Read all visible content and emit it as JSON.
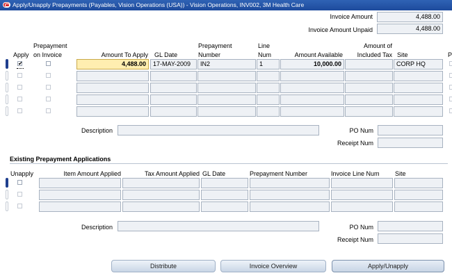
{
  "window": {
    "title": "Apply/Unapply Prepayments (Payables, Vision Operations (USA)) - Vision Operations, INV002, 3M Health Care"
  },
  "header": {
    "invoice_amount_label": "Invoice Amount",
    "invoice_amount_value": "4,488.00",
    "invoice_amount_unpaid_label": "Invoice Amount Unpaid",
    "invoice_amount_unpaid_value": "4,488.00"
  },
  "prepay_table": {
    "columns": {
      "apply": "Apply",
      "prepayment_on_invoice_1": "Prepayment",
      "prepayment_on_invoice_2": "on Invoice",
      "amount_to_apply": "Amount To Apply",
      "gl_date": "GL Date",
      "prepayment_number_1": "Prepayment",
      "prepayment_number_2": "Number",
      "line_num_1": "Line",
      "line_num_2": "Num",
      "amount_available": "Amount Available",
      "included_tax_1": "Amount of",
      "included_tax_2": "Included Tax",
      "site": "Site",
      "next_col": "P"
    },
    "rows": [
      {
        "apply": "✔",
        "amount_to_apply": "4,488.00",
        "gl_date": "17-MAY-2009",
        "prepayment_number": "IN2",
        "line_num": "1",
        "amount_available": "10,000.00",
        "included_tax": "",
        "site": "CORP HQ"
      },
      {
        "apply": "",
        "amount_to_apply": "",
        "gl_date": "",
        "prepayment_number": "",
        "line_num": "",
        "amount_available": "",
        "included_tax": "",
        "site": ""
      },
      {
        "apply": "",
        "amount_to_apply": "",
        "gl_date": "",
        "prepayment_number": "",
        "line_num": "",
        "amount_available": "",
        "included_tax": "",
        "site": ""
      },
      {
        "apply": "",
        "amount_to_apply": "",
        "gl_date": "",
        "prepayment_number": "",
        "line_num": "",
        "amount_available": "",
        "included_tax": "",
        "site": ""
      },
      {
        "apply": "",
        "amount_to_apply": "",
        "gl_date": "",
        "prepayment_number": "",
        "line_num": "",
        "amount_available": "",
        "included_tax": "",
        "site": ""
      }
    ],
    "description_label": "Description",
    "po_num_label": "PO Num",
    "receipt_num_label": "Receipt Num"
  },
  "existing": {
    "title": "Existing Prepayment Applications",
    "columns": {
      "unapply": "Unapply",
      "item_amount_applied": "Item Amount Applied",
      "tax_amount_applied": "Tax Amount Applied",
      "gl_date": "GL Date",
      "prepayment_number": "Prepayment Number",
      "invoice_line_num": "Invoice Line Num",
      "site": "Site"
    },
    "description_label": "Description",
    "po_num_label": "PO Num",
    "receipt_num_label": "Receipt Num"
  },
  "buttons": {
    "distribute": "Distribute",
    "invoice_overview": "Invoice Overview",
    "apply_unapply": "Apply/Unapply"
  }
}
